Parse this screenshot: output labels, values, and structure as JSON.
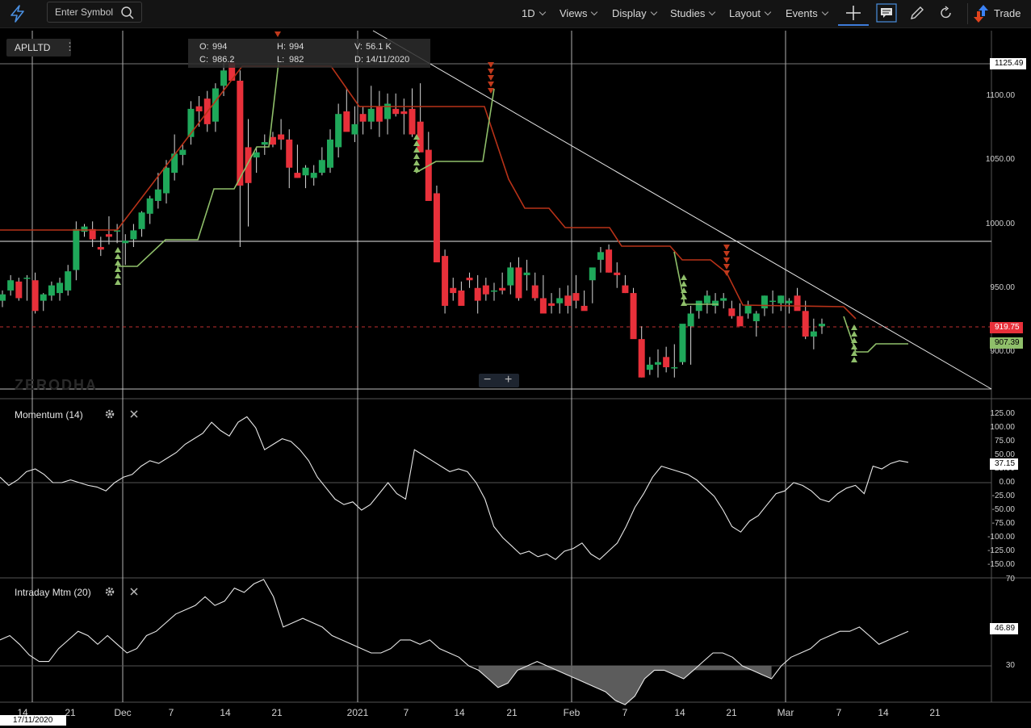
{
  "toolbar": {
    "search_placeholder": "Enter Symbol",
    "menus": [
      "1D",
      "Views",
      "Display",
      "Studies",
      "Layout",
      "Events"
    ],
    "trade_label": "Trade"
  },
  "symbol": "APLLTD",
  "ohlc": {
    "o_label": "O:",
    "o": "994",
    "c_label": "C:",
    "c": "986.2",
    "h_label": "H:",
    "h": "994",
    "l_label": "L:",
    "l": "982",
    "v_label": "V:",
    "v": "56.1 K",
    "d_label": "D:",
    "d": "14/11/2020"
  },
  "watermark": "ZERODHA",
  "zoom": {
    "minus": "−",
    "plus": "+"
  },
  "panels": {
    "momentum": {
      "title": "Momentum (14)"
    },
    "intraday": {
      "title": "Intraday Mtm (20)"
    }
  },
  "price_axis": [
    "1100.00",
    "1050.00",
    "1000.00",
    "950.00",
    "900.00"
  ],
  "price_tags": {
    "top": "1125.49",
    "last": "919.75",
    "stop": "907.39"
  },
  "momentum_axis": [
    "125.00",
    "100.00",
    "75.00",
    "50.00",
    "25.00",
    "0.00",
    "-25.00",
    "-50.00",
    "-75.00",
    "-100.00",
    "-125.00",
    "-150.00"
  ],
  "momentum_tag": "37.15",
  "intraday_axis": [
    "70",
    "30"
  ],
  "intraday_tag": "46.89",
  "x_labels": [
    "14",
    "21",
    "Dec",
    "7",
    "14",
    "21",
    "2021",
    "7",
    "14",
    "21",
    "Feb",
    "7",
    "14",
    "21",
    "Mar",
    "7",
    "14",
    "21"
  ],
  "crosshair_date": "17/11/2020",
  "colors": {
    "up": "#1fa85a",
    "down": "#e8303a",
    "stop_up": "#8fbf6a",
    "stop_down": "#b83218",
    "bg": "#000000"
  },
  "chart_data": [
    {
      "type": "candlestick",
      "title": "",
      "ylim": [
        878,
        1135
      ],
      "candles": [
        [
          940,
          948,
          935,
          945
        ],
        [
          948,
          960,
          944,
          956
        ],
        [
          955,
          958,
          940,
          942
        ],
        [
          958,
          960,
          940,
          958
        ],
        [
          956,
          962,
          930,
          932
        ],
        [
          940,
          946,
          932,
          945
        ],
        [
          944,
          955,
          940,
          952
        ],
        [
          946,
          958,
          940,
          954
        ],
        [
          948,
          968,
          944,
          963
        ],
        [
          964,
          1002,
          956,
          996
        ],
        [
          994,
          1000,
          990,
          998
        ],
        [
          996,
          1002,
          982,
          988
        ],
        [
          982,
          990,
          975,
          980
        ],
        [
          992,
          1006,
          984,
          990
        ],
        [
          995,
          1000,
          985,
          995
        ],
        [
          985,
          992,
          968,
          987
        ],
        [
          988,
          1000,
          982,
          995
        ],
        [
          996,
          1010,
          990,
          1009
        ],
        [
          1008,
          1022,
          1000,
          1020
        ],
        [
          1018,
          1040,
          1012,
          1027
        ],
        [
          1024,
          1050,
          1016,
          1044
        ],
        [
          1040,
          1070,
          1034,
          1055
        ],
        [
          1054,
          1062,
          1046,
          1058
        ],
        [
          1068,
          1096,
          1062,
          1090
        ],
        [
          1092,
          1100,
          1076,
          1088
        ],
        [
          1098,
          1104,
          1072,
          1078
        ],
        [
          1080,
          1110,
          1072,
          1106
        ],
        [
          1108,
          1126,
          1100,
          1120
        ],
        [
          1126,
          1132,
          1118,
          1112
        ],
        [
          1112,
          1120,
          982,
          1030
        ],
        [
          1060,
          1082,
          998,
          1032
        ],
        [
          1052,
          1060,
          1040,
          1056
        ],
        [
          1062,
          1070,
          1054,
          1064
        ],
        [
          1068,
          1072,
          1060,
          1062
        ],
        [
          1070,
          1082,
          1058,
          1066
        ],
        [
          1066,
          1074,
          1028,
          1044
        ],
        [
          1040,
          1062,
          1036,
          1036
        ],
        [
          1038,
          1046,
          1028,
          1044
        ],
        [
          1036,
          1046,
          1030,
          1040
        ],
        [
          1040,
          1060,
          1038,
          1050
        ],
        [
          1044,
          1074,
          1040,
          1066
        ],
        [
          1060,
          1094,
          1052,
          1086
        ],
        [
          1088,
          1106,
          1076,
          1072
        ],
        [
          1070,
          1092,
          1064,
          1078
        ],
        [
          1086,
          1092,
          1070,
          1080
        ],
        [
          1080,
          1108,
          1074,
          1090
        ],
        [
          1092,
          1104,
          1068,
          1080
        ],
        [
          1082,
          1102,
          1070,
          1094
        ],
        [
          1090,
          1102,
          1084,
          1086
        ],
        [
          1088,
          1098,
          1070,
          1086
        ],
        [
          1090,
          1106,
          1068,
          1070
        ],
        [
          1080,
          1110,
          1074,
          1056
        ],
        [
          1058,
          1072,
          1044,
          1018
        ],
        [
          1024,
          1030,
          978,
          970
        ],
        [
          975,
          980,
          930,
          936
        ],
        [
          950,
          958,
          940,
          946
        ],
        [
          948,
          955,
          938,
          936
        ],
        [
          958,
          962,
          950,
          956
        ],
        [
          950,
          960,
          930,
          940
        ],
        [
          952,
          958,
          940,
          945
        ],
        [
          948,
          954,
          940,
          948
        ],
        [
          950,
          962,
          945,
          948
        ],
        [
          952,
          970,
          945,
          966
        ],
        [
          966,
          974,
          940,
          942
        ],
        [
          960,
          972,
          948,
          962
        ],
        [
          952,
          962,
          940,
          942
        ],
        [
          942,
          960,
          935,
          930
        ],
        [
          938,
          946,
          930,
          936
        ],
        [
          938,
          950,
          930,
          942
        ],
        [
          944,
          952,
          930,
          936
        ],
        [
          946,
          960,
          934,
          940
        ],
        [
          936,
          948,
          934,
          932
        ],
        [
          956,
          964,
          938,
          966
        ],
        [
          972,
          982,
          962,
          978
        ],
        [
          980,
          984,
          962,
          962
        ],
        [
          962,
          970,
          950,
          960
        ],
        [
          952,
          960,
          946,
          946
        ],
        [
          946,
          950,
          922,
          910
        ],
        [
          910,
          920,
          880,
          880
        ],
        [
          886,
          896,
          882,
          890
        ],
        [
          890,
          902,
          880,
          892
        ],
        [
          896,
          904,
          884,
          888
        ],
        [
          888,
          906,
          880,
          888
        ],
        [
          892,
          920,
          890,
          922
        ],
        [
          920,
          936,
          890,
          930
        ],
        [
          932,
          940,
          926,
          940
        ],
        [
          938,
          948,
          930,
          944
        ],
        [
          936,
          946,
          930,
          940
        ],
        [
          940,
          946,
          934,
          942
        ],
        [
          934,
          940,
          926,
          928
        ],
        [
          928,
          938,
          924,
          920
        ],
        [
          930,
          940,
          926,
          936
        ],
        [
          924,
          932,
          912,
          930
        ],
        [
          934,
          944,
          928,
          944
        ],
        [
          940,
          948,
          930,
          940
        ],
        [
          938,
          944,
          932,
          944
        ],
        [
          938,
          942,
          930,
          940
        ],
        [
          944,
          950,
          936,
          932
        ],
        [
          932,
          940,
          910,
          912
        ],
        [
          912,
          926,
          902,
          916
        ],
        [
          920,
          926,
          914,
          922
        ]
      ],
      "annotations": [
        "trendline",
        "horizontal_level"
      ]
    },
    {
      "type": "line",
      "title": "Momentum (14)",
      "ylim": [
        -160,
        140
      ],
      "values": [
        10,
        -5,
        5,
        20,
        25,
        15,
        0,
        0,
        5,
        0,
        -5,
        -8,
        -15,
        0,
        10,
        15,
        30,
        40,
        35,
        45,
        55,
        70,
        80,
        90,
        110,
        95,
        85,
        110,
        120,
        100,
        60,
        70,
        80,
        75,
        60,
        40,
        10,
        -10,
        -30,
        -40,
        -35,
        -50,
        -40,
        -20,
        0,
        -20,
        -30,
        60,
        50,
        40,
        30,
        20,
        25,
        20,
        0,
        -30,
        -80,
        -100,
        -115,
        -130,
        -125,
        -135,
        -130,
        -140,
        -125,
        -120,
        -110,
        -130,
        -140,
        -125,
        -110,
        -80,
        -45,
        -20,
        10,
        30,
        25,
        20,
        15,
        5,
        -10,
        -25,
        -50,
        -80,
        -90,
        -70,
        -60,
        -40,
        -20,
        -15,
        0,
        -5,
        -15,
        -30,
        -35,
        -20,
        -10,
        -5,
        -20,
        30,
        25,
        35,
        40,
        37
      ]
    },
    {
      "type": "line",
      "title": "Intraday Mtm (20)",
      "ylim": [
        10,
        75
      ],
      "values": [
        42,
        44,
        40,
        35,
        32,
        32,
        38,
        42,
        46,
        44,
        40,
        44,
        40,
        36,
        38,
        44,
        46,
        50,
        54,
        56,
        58,
        62,
        58,
        60,
        66,
        64,
        68,
        70,
        62,
        48,
        50,
        52,
        50,
        48,
        44,
        42,
        40,
        38,
        36,
        36,
        38,
        42,
        42,
        40,
        42,
        38,
        36,
        34,
        30,
        28,
        24,
        20,
        22,
        28,
        30,
        32,
        30,
        28,
        26,
        24,
        22,
        20,
        18,
        14,
        12,
        16,
        24,
        28,
        28,
        26,
        24,
        28,
        32,
        36,
        36,
        34,
        30,
        28,
        26,
        24,
        30,
        34,
        36,
        38,
        42,
        44,
        46,
        46,
        48,
        44,
        40,
        42,
        44,
        46
      ]
    }
  ]
}
